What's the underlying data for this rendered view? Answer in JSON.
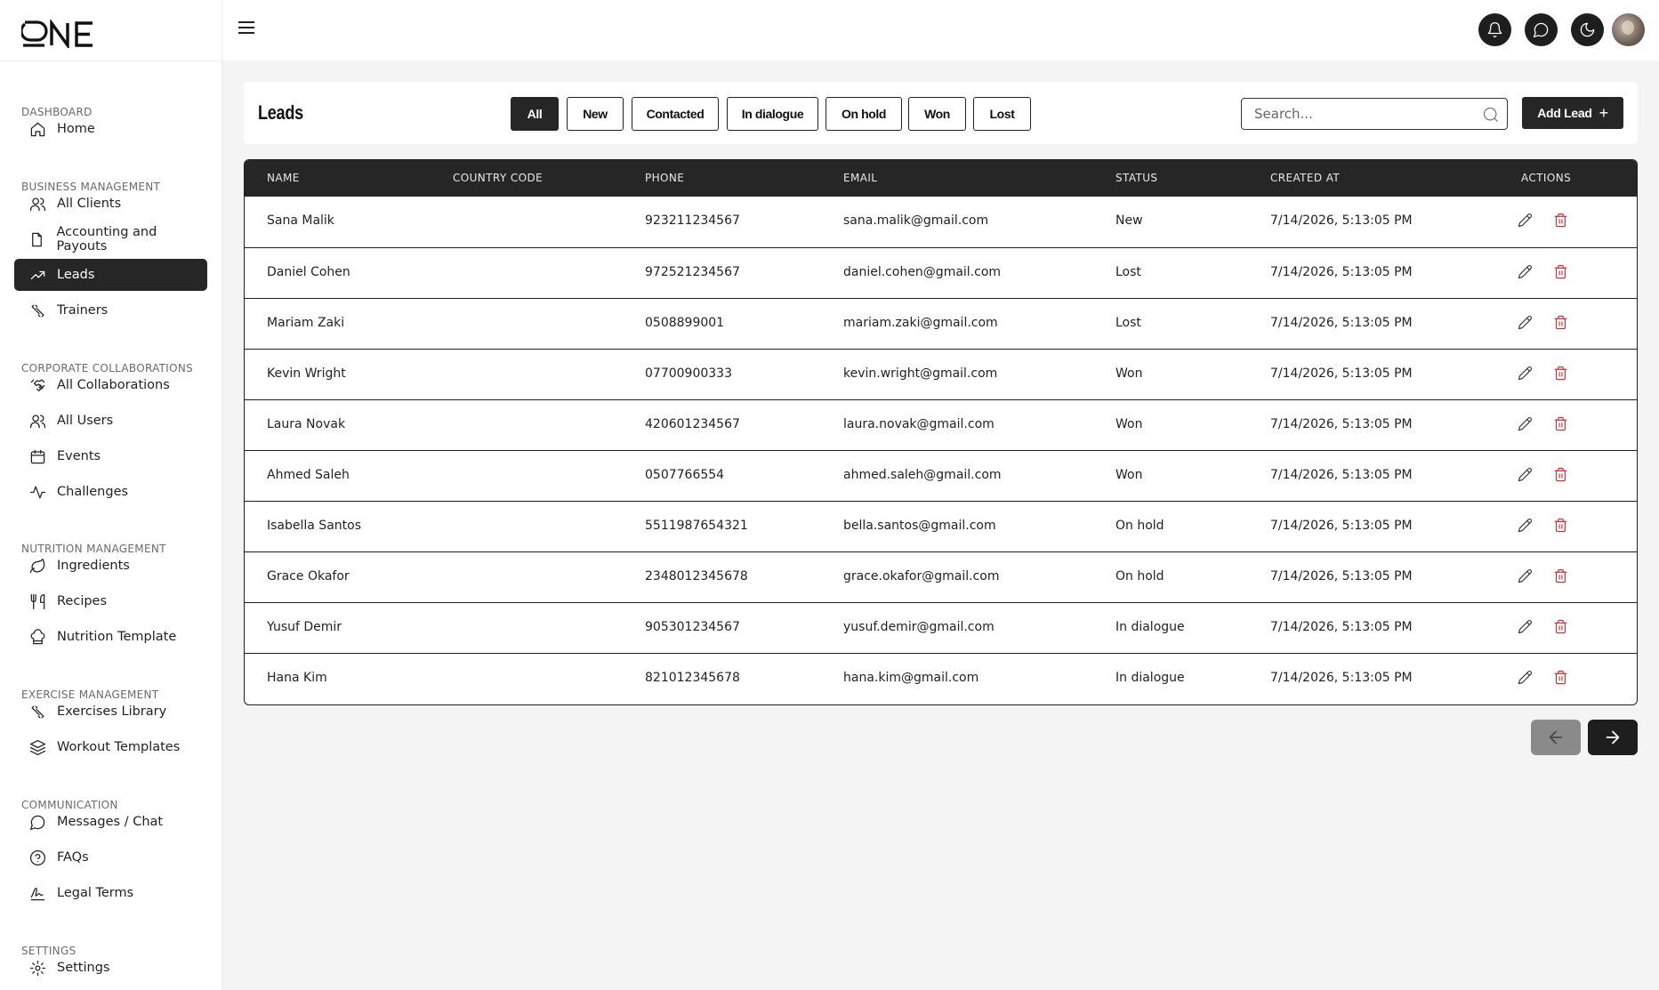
{
  "app": {
    "logo_text": "ONE"
  },
  "sidebar": {
    "sections": [
      {
        "title": "DASHBOARD",
        "items": [
          {
            "label": "Home",
            "icon": "home-icon"
          }
        ]
      },
      {
        "title": "BUSINESS MANAGEMENT",
        "items": [
          {
            "label": "All Clients",
            "icon": "users-icon"
          },
          {
            "label": "Accounting and Payouts",
            "icon": "file-icon"
          },
          {
            "label": "Leads",
            "icon": "trending-up-icon",
            "active": true
          },
          {
            "label": "Trainers",
            "icon": "dumbbell-icon"
          }
        ]
      },
      {
        "title": "CORPORATE COLLABORATIONS",
        "items": [
          {
            "label": "All Collaborations",
            "icon": "handshake-icon"
          },
          {
            "label": "All Users",
            "icon": "users-icon"
          },
          {
            "label": "Events",
            "icon": "calendar-icon"
          },
          {
            "label": "Challenges",
            "icon": "activity-icon"
          }
        ]
      },
      {
        "title": "NUTRITION MANAGEMENT",
        "items": [
          {
            "label": "Ingredients",
            "icon": "leaf-icon"
          },
          {
            "label": "Recipes",
            "icon": "utensils-icon"
          },
          {
            "label": "Nutrition Template",
            "icon": "chef-hat-icon"
          }
        ]
      },
      {
        "title": "EXERCISE MANAGEMENT",
        "items": [
          {
            "label": "Exercises Library",
            "icon": "dumbbell-icon"
          },
          {
            "label": "Workout Templates",
            "icon": "layers-icon"
          }
        ]
      },
      {
        "title": "COMMUNICATION",
        "items": [
          {
            "label": "Messages / Chat",
            "icon": "message-circle-icon"
          },
          {
            "label": "FAQs",
            "icon": "help-circle-icon"
          },
          {
            "label": "Legal Terms",
            "icon": "signature-icon"
          }
        ]
      },
      {
        "title": "SETTINGS",
        "items": [
          {
            "label": "Settings",
            "icon": "gear-icon"
          }
        ]
      }
    ]
  },
  "topbar": {
    "icons": [
      "bell-icon",
      "chat-icon",
      "moon-icon"
    ]
  },
  "leads": {
    "title": "Leads",
    "filters": [
      "All",
      "New",
      "Contacted",
      "In dialogue",
      "On hold",
      "Won",
      "Lost"
    ],
    "active_filter": "All",
    "search_placeholder": "Search...",
    "search_value": "",
    "add_label": "Add Lead",
    "add_icon": "+"
  },
  "table": {
    "columns": [
      "NAME",
      "COUNTRY CODE",
      "PHONE",
      "EMAIL",
      "STATUS",
      "CREATED AT",
      "ACTIONS"
    ],
    "rows": [
      {
        "name": "Sana Malik",
        "country_code": "",
        "phone": "923211234567",
        "email": "sana.malik@gmail.com",
        "status": "New",
        "created": "7/14/2026, 5:13:05 PM"
      },
      {
        "name": "Daniel Cohen",
        "country_code": "",
        "phone": "972521234567",
        "email": "daniel.cohen@gmail.com",
        "status": "Lost",
        "created": "7/14/2026, 5:13:05 PM"
      },
      {
        "name": "Mariam Zaki",
        "country_code": "",
        "phone": "0508899001",
        "email": "mariam.zaki@gmail.com",
        "status": "Lost",
        "created": "7/14/2026, 5:13:05 PM"
      },
      {
        "name": "Kevin Wright",
        "country_code": "",
        "phone": "07700900333",
        "email": "kevin.wright@gmail.com",
        "status": "Won",
        "created": "7/14/2026, 5:13:05 PM"
      },
      {
        "name": "Laura Novak",
        "country_code": "",
        "phone": "420601234567",
        "email": "laura.novak@gmail.com",
        "status": "Won",
        "created": "7/14/2026, 5:13:05 PM"
      },
      {
        "name": "Ahmed Saleh",
        "country_code": "",
        "phone": "0507766554",
        "email": "ahmed.saleh@gmail.com",
        "status": "Won",
        "created": "7/14/2026, 5:13:05 PM"
      },
      {
        "name": "Isabella Santos",
        "country_code": "",
        "phone": "5511987654321",
        "email": "bella.santos@gmail.com",
        "status": "On hold",
        "created": "7/14/2026, 5:13:05 PM"
      },
      {
        "name": "Grace Okafor",
        "country_code": "",
        "phone": "2348012345678",
        "email": "grace.okafor@gmail.com",
        "status": "On hold",
        "created": "7/14/2026, 5:13:05 PM"
      },
      {
        "name": "Yusuf Demir",
        "country_code": "",
        "phone": "905301234567",
        "email": "yusuf.demir@gmail.com",
        "status": "In dialogue",
        "created": "7/14/2026, 5:13:05 PM"
      },
      {
        "name": "Hana Kim",
        "country_code": "",
        "phone": "821012345678",
        "email": "hana.kim@gmail.com",
        "status": "In dialogue",
        "created": "7/14/2026, 5:13:05 PM"
      }
    ]
  },
  "pagination": {
    "prev_icon": "arrow-left-icon",
    "next_icon": "arrow-right-icon",
    "prev_disabled": true
  },
  "colors": {
    "primary": "#262626",
    "delete": "#e0262c",
    "background": "#f4f4f4"
  }
}
